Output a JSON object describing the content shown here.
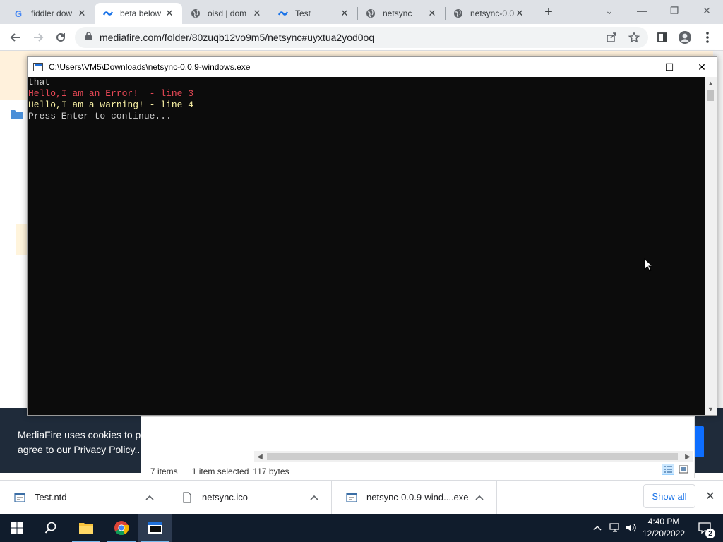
{
  "browser": {
    "tabs": [
      {
        "title": "fiddler dow",
        "icon": "google-icon",
        "active": false
      },
      {
        "title": "beta below",
        "icon": "wave-icon",
        "active": true
      },
      {
        "title": "oisd | dom",
        "icon": "globe-icon",
        "active": false
      },
      {
        "title": "Test",
        "icon": "wave-icon",
        "active": false
      },
      {
        "title": "netsync",
        "icon": "globe-icon",
        "active": false
      },
      {
        "title": "netsync-0.0",
        "icon": "globe-icon",
        "active": false
      }
    ],
    "url": "mediafire.com/folder/80zuqb12vo9m5/netsync#uyxtua2yod0oq"
  },
  "console": {
    "title": "C:\\Users\\VM5\\Downloads\\netsync-0.0.9-windows.exe",
    "lines": [
      {
        "text": "that",
        "level": "normal"
      },
      {
        "text": "Hello,I am an Error!  - line 3",
        "level": "error"
      },
      {
        "text": "Hello,I am a warning! - line 4",
        "level": "warning"
      },
      {
        "text": "Press Enter to continue...",
        "level": "normal"
      }
    ]
  },
  "cookie_banner": {
    "line1": "MediaFire uses cookies to pr",
    "line2": "agree to our Privacy Policy.."
  },
  "explorer": {
    "items": "7 items",
    "selected": "1 item selected",
    "size": "117 bytes"
  },
  "downloads": {
    "items": [
      {
        "name": "Test.ntd",
        "icon": "document-icon"
      },
      {
        "name": "netsync.ico",
        "icon": "file-icon"
      },
      {
        "name": "netsync-0.0.9-wind....exe",
        "icon": "exe-icon"
      }
    ],
    "show_all": "Show all"
  },
  "taskbar": {
    "time": "4:40 PM",
    "date": "12/20/2022",
    "notifications": "2"
  },
  "colors": {
    "error": "#e74856",
    "warning": "#f9f1a5",
    "console_bg": "#0c0c0c",
    "link": "#1a73e8"
  }
}
